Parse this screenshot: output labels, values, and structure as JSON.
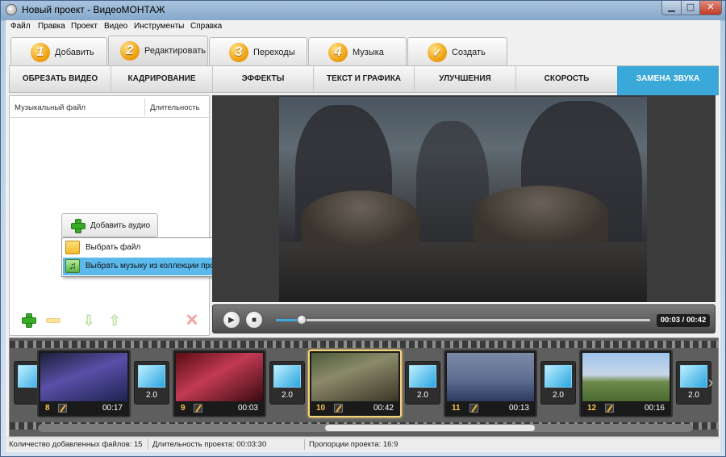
{
  "window": {
    "title": "Новый проект - ВидеоМОНТАЖ",
    "min_glyph": "▁",
    "max_glyph": "□",
    "close_glyph": "✕"
  },
  "menu": [
    "Файл",
    "Правка",
    "Проект",
    "Видео",
    "Инструменты",
    "Справка"
  ],
  "steps": [
    {
      "num": "1",
      "label": "Добавить"
    },
    {
      "num": "2",
      "label": "Редактировать",
      "active": true
    },
    {
      "num": "3",
      "label": "Переходы"
    },
    {
      "num": "4",
      "label": "Музыка"
    },
    {
      "num": "✓",
      "label": "Создать"
    }
  ],
  "subtabs": [
    {
      "label": "ОБРЕЗАТЬ ВИДЕО"
    },
    {
      "label": "КАДРИРОВАНИЕ"
    },
    {
      "label": "ЭФФЕКТЫ"
    },
    {
      "label": "ТЕКСТ И ГРАФИКА"
    },
    {
      "label": "УЛУЧШЕНИЯ"
    },
    {
      "label": "СКОРОСТЬ"
    },
    {
      "label": "ЗАМЕНА ЗВУКА",
      "active": true
    }
  ],
  "music_panel": {
    "col_file": "Музыкальный файл",
    "col_duration": "Длительность",
    "add_audio": "Добавить аудио",
    "popup": [
      {
        "label": "Выбрать файл",
        "icon": "folder-icon"
      },
      {
        "label": "Выбрать музыку из коллекции программы",
        "icon": "music-note-icon",
        "highlighted": true
      }
    ]
  },
  "player": {
    "time": "00:03 / 00:42",
    "progress_fraction": 0.07
  },
  "clips": [
    {
      "num": "8",
      "duration": "00:17"
    },
    {
      "num": "9",
      "duration": "00:03"
    },
    {
      "num": "10",
      "duration": "00:42",
      "selected": true
    },
    {
      "num": "11",
      "duration": "00:13"
    },
    {
      "num": "12",
      "duration": "00:16"
    }
  ],
  "transitions": [
    "2.0",
    "2.0",
    "2.0",
    "2.0",
    "2.0"
  ],
  "status": {
    "files": "Количество добавленных файлов: 15",
    "duration": "Длительность проекта:  00:03:30",
    "ratio": "Пропорции проекта:  16:9"
  },
  "colors": {
    "accent": "#3aa8d8",
    "step_badge": "#f0a414",
    "selected_clip": "#f4d27a"
  }
}
